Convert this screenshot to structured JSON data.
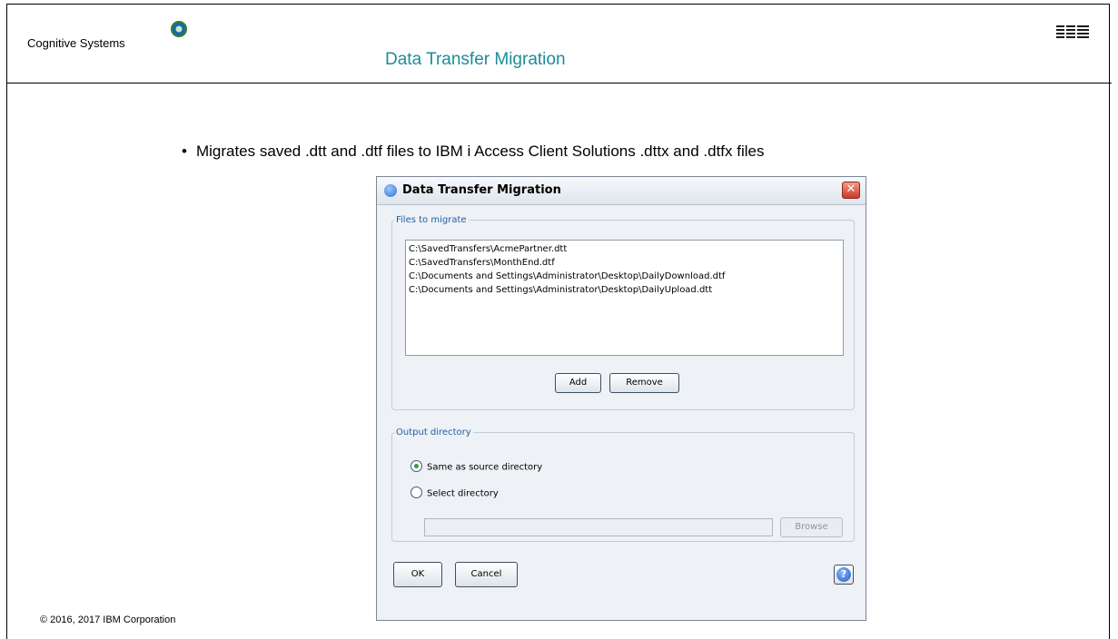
{
  "slide": {
    "brand": "Cognitive Systems",
    "title": "Data Transfer Migration",
    "bullet": "Migrates saved .dtt and .dtf files to IBM i Access Client Solutions .dttx and .dtfx files",
    "copyright": "© 2016, 2017 IBM Corporation"
  },
  "dialog": {
    "title": "Data Transfer Migration",
    "close_label": "✕",
    "files_group_label": "Files to migrate",
    "files": [
      "C:\\SavedTransfers\\AcmePartner.dtt",
      "C:\\SavedTransfers\\MonthEnd.dtf",
      "C:\\Documents and Settings\\Administrator\\Desktop\\DailyDownload.dtf",
      "C:\\Documents and Settings\\Administrator\\Desktop\\DailyUpload.dtt"
    ],
    "add_label": "Add",
    "remove_label": "Remove",
    "output_group_label": "Output directory",
    "same_dir_label": "Same as source directory",
    "select_dir_label": "Select directory",
    "selected_option": "Same as source directory",
    "directory_value": "",
    "browse_label": "Browse",
    "ok_label": "OK",
    "cancel_label": "Cancel",
    "help_label": "?"
  },
  "colors": {
    "title_accent": "#1c8c9a",
    "legend_blue": "#1f5fa8"
  },
  "icons": [
    "cognitive-systems-logo-icon",
    "ibm-logo-icon",
    "app-icon",
    "close-icon",
    "help-icon"
  ]
}
